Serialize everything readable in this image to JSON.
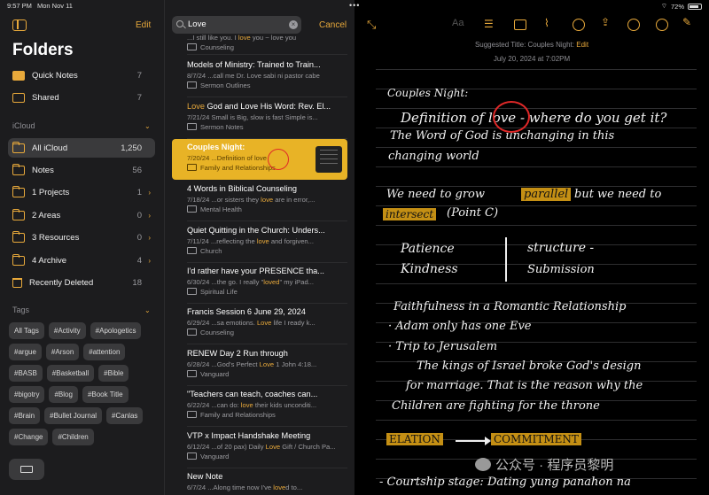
{
  "statusbar": {
    "time": "9:57 PM",
    "date": "Mon Nov 11",
    "battery": "72%"
  },
  "sidebar": {
    "edit_label": "Edit",
    "title": "Folders",
    "top_items": [
      {
        "label": "Quick Notes",
        "count": "7"
      },
      {
        "label": "Shared",
        "count": "7"
      }
    ],
    "icloud_label": "iCloud",
    "folders": [
      {
        "label": "All iCloud",
        "count": "1,250"
      },
      {
        "label": "Notes",
        "count": "56"
      },
      {
        "label": "1 Projects",
        "count": "1"
      },
      {
        "label": "2 Areas",
        "count": "0"
      },
      {
        "label": "3 Resources",
        "count": "0"
      },
      {
        "label": "4 Archive",
        "count": "4"
      },
      {
        "label": "Recently Deleted",
        "count": "18"
      }
    ],
    "tags_label": "Tags",
    "tags": [
      "All Tags",
      "#Activity",
      "#Apologetics",
      "#argue",
      "#Arson",
      "#attention",
      "#BASB",
      "#Basketball",
      "#Bible",
      "#bigotry",
      "#Blog",
      "#Book Title",
      "#Brain",
      "#Bullet Journal",
      "#Canlas",
      "#Change",
      "#Children"
    ]
  },
  "notelist": {
    "search_value": "Love",
    "cancel_label": "Cancel",
    "notes": [
      {
        "title": "",
        "snippet_pre": "...I still like you. I ",
        "snippet_hl": "love",
        "snippet_post": " you ~ love you",
        "folder": "Counseling"
      },
      {
        "title": "Models of Ministry: Trained to Train...",
        "snippet_pre": "8/7/24  ...call me Dr. Love sabi ni pastor cabe",
        "snippet_hl": "",
        "snippet_post": "",
        "folder": "Sermon Outlines"
      },
      {
        "title_hl": "Love",
        "title": " God and Love His Word: Rev. El...",
        "snippet_pre": "7/21/24  Small is Big, slow is fast Simple is...",
        "snippet_hl": "",
        "snippet_post": "",
        "folder": "Sermon Notes"
      },
      {
        "title": "Couples Night:",
        "snippet_pre": "7/20/24  ...Definition of ",
        "snippet_hl": "love",
        "snippet_post": "",
        "folder": "Family and Relationships"
      },
      {
        "title": "4 Words in Biblical Counseling",
        "snippet_pre": "7/18/24  ...or sisters they ",
        "snippet_hl": "love",
        "snippet_post": " are in error,...",
        "folder": "Mental Health"
      },
      {
        "title": "Quiet Quitting in the Church: Unders...",
        "snippet_pre": "7/11/24  ...reflecting the ",
        "snippet_hl": "love",
        "snippet_post": " and forgiven...",
        "folder": "Church"
      },
      {
        "title": "I'd rather have your PRESENCE tha...",
        "snippet_pre": "6/30/24  ...the go. I really \"",
        "snippet_hl": "loved",
        "snippet_post": "\" my iPad...",
        "folder": "Spiritual Life"
      },
      {
        "title": "Francis Session 6 June 29, 2024",
        "snippet_pre": "6/29/24  ...sa emotions. ",
        "snippet_hl": "Love",
        "snippet_post": " life I ready k...",
        "folder": "Counseling"
      },
      {
        "title": "RENEW Day 2 Run through",
        "snippet_pre": "6/28/24  ...God's Perfect ",
        "snippet_hl": "Love",
        "snippet_post": " 1 John 4:18...",
        "folder": "Vanguard"
      },
      {
        "title": "\"Teachers can teach, coaches can...",
        "snippet_pre": "6/22/24  ...can do: ",
        "snippet_hl": "love",
        "snippet_post": " their kids unconditi...",
        "folder": "Family and Relationships"
      },
      {
        "title": "VTP x Impact Handshake Meeting",
        "snippet_pre": "6/12/24  ...of 20 pax) Daily ",
        "snippet_hl": "Love",
        "snippet_post": " Gift / Church Pa...",
        "folder": "Vanguard"
      },
      {
        "title": "New Note",
        "snippet_pre": "6/7/24  ...Along time now I've ",
        "snippet_hl": "love",
        "snippet_post": "d to...",
        "folder": ""
      }
    ]
  },
  "editor": {
    "suggested_title_label": "Suggested Title: Couples Night:",
    "suggested_edit_label": "Edit",
    "date_line": "July 20, 2024 at 7:02PM",
    "handwriting": [
      "Couples Night:",
      "Definition of love - where do you get it?",
      "The Word of God is unchanging in this",
      "changing world",
      "We need to grow",
      "parallel",
      "but we need to",
      "intersect",
      "(Point C)",
      "Patience",
      "Kindness",
      "structure -",
      "Submission",
      "Faithfulness in a Romantic Relationship",
      "· Adam only has one Eve",
      "· Trip to Jerusalem",
      "The kings of Israel broke God's design",
      "for marriage. That is the reason why the",
      "Children are fighting for the throne",
      "ELATION",
      "COMMITMENT",
      "- Courtship stage: Dating yung panahon na"
    ],
    "watermark": "公众号 · 程序员黎明"
  }
}
